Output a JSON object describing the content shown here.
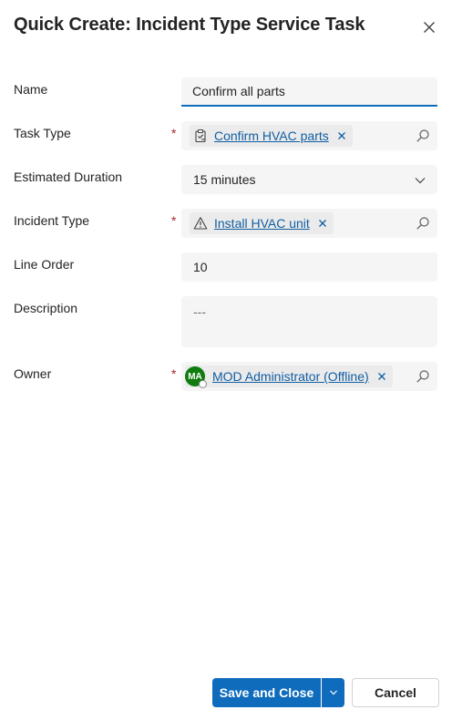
{
  "dialog": {
    "title": "Quick Create: Incident Type Service Task"
  },
  "fields": {
    "name": {
      "label": "Name",
      "value": "Confirm all parts"
    },
    "task_type": {
      "label": "Task Type",
      "required_mark": "*",
      "value": "Confirm HVAC parts"
    },
    "estimated_duration": {
      "label": "Estimated Duration",
      "value": "15 minutes"
    },
    "incident_type": {
      "label": "Incident Type",
      "required_mark": "*",
      "value": "Install HVAC unit"
    },
    "line_order": {
      "label": "Line Order",
      "value": "10"
    },
    "description": {
      "label": "Description",
      "placeholder": "---"
    },
    "owner": {
      "label": "Owner",
      "required_mark": "*",
      "initials": "MA",
      "value": "MOD Administrator (Offline)"
    }
  },
  "footer": {
    "save_close_label": "Save and Close",
    "cancel_label": "Cancel"
  },
  "colors": {
    "accent": "#0f6cbd",
    "link": "#115ea3",
    "required": "#a4262c",
    "avatar": "#107c10"
  }
}
